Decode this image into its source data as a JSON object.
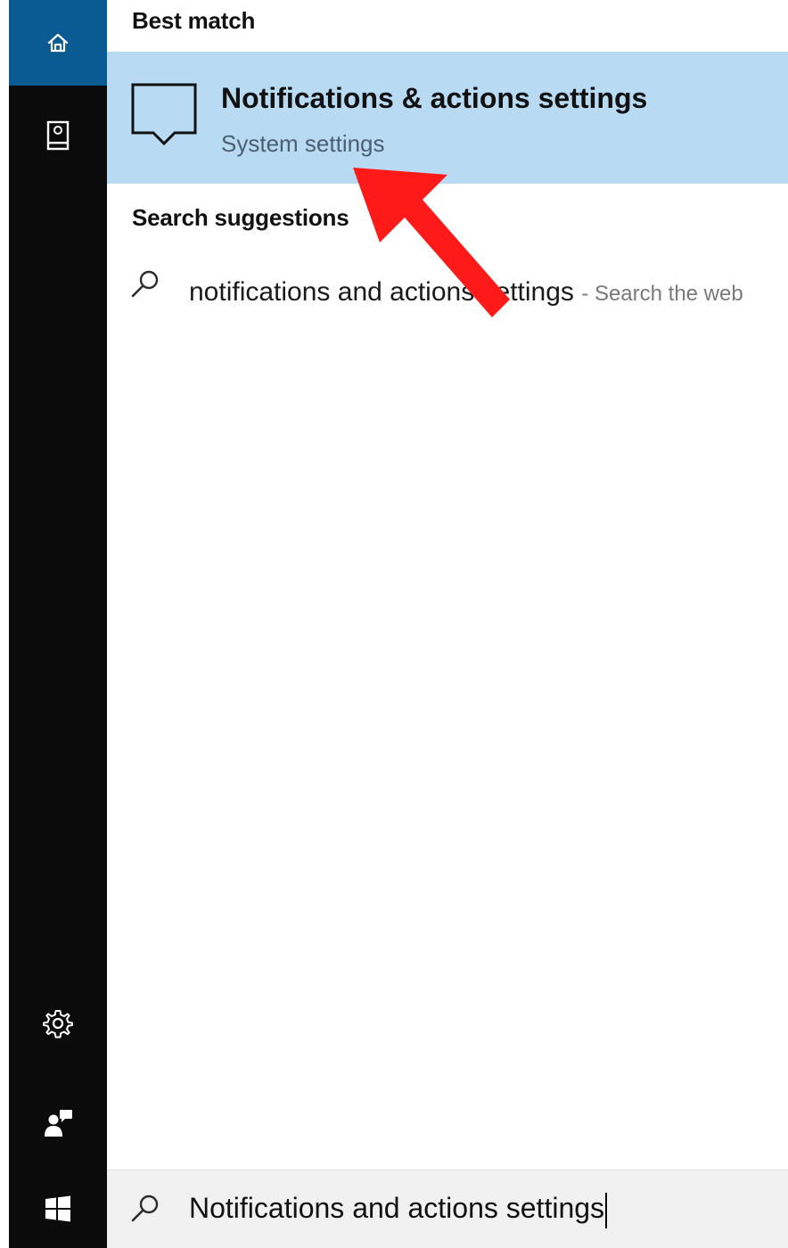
{
  "best_match": {
    "heading": "Best match",
    "title": "Notifications & actions settings",
    "subtitle": "System settings",
    "icon": "notification-bubble-icon"
  },
  "suggestions": {
    "heading": "Search suggestions",
    "items": [
      {
        "query": "notifications and actions settings",
        "hint": "- Search the web"
      }
    ]
  },
  "search": {
    "value": "Notifications and actions settings"
  },
  "rail": {
    "icons": [
      "home-icon",
      "notebook-icon",
      "settings-gear-icon",
      "feedback-icon",
      "windows-start-icon"
    ]
  },
  "colors": {
    "rail_bg": "#0b0b0b",
    "rail_selected": "#0a5a93",
    "selection_bg": "#b8daf3",
    "annotation": "#ff1a1a"
  }
}
